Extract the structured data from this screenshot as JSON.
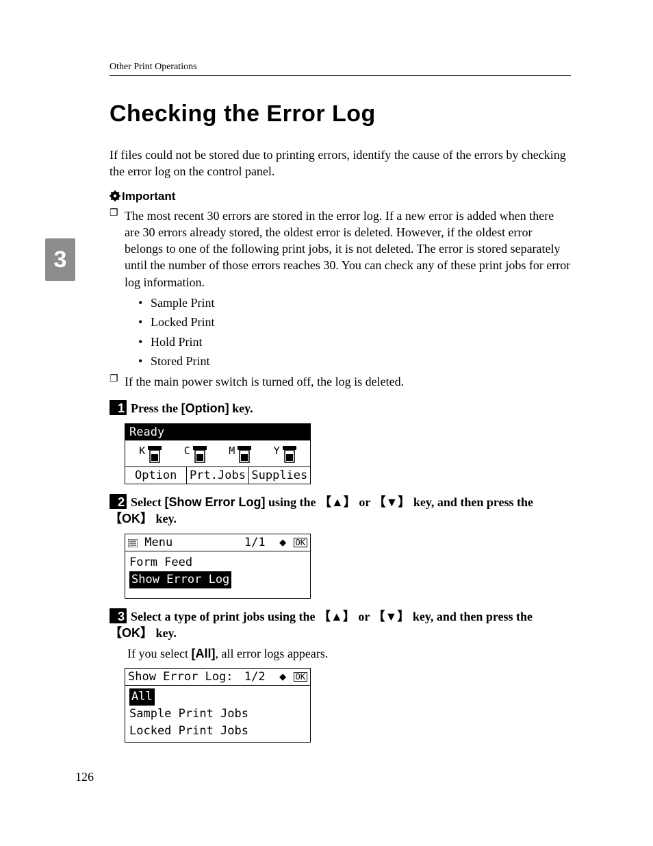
{
  "running_head": "Other Print Operations",
  "title": "Checking the Error Log",
  "chapter_tab": "3",
  "intro": "If files could not be stored due to printing errors, identify the cause of the errors by checking the error log on the control panel.",
  "important_label": "Important",
  "important_items": [
    "The most recent 30 errors are stored in the error log. If a new error is added when there are 30 errors already stored, the oldest error is deleted. However, if the oldest error belongs to one of the following print jobs, it is not deleted. The error is stored separately until the number of those errors reaches 30. You can check any of these print jobs for error log information.",
    "If the main power switch is turned off, the log is deleted."
  ],
  "print_job_types": [
    "Sample Print",
    "Locked Print",
    "Hold Print",
    "Stored Print"
  ],
  "steps": [
    {
      "num": "1",
      "text_prefix": "Press the ",
      "key": "[Option]",
      "text_suffix": " key."
    },
    {
      "num": "2",
      "text_prefix": "Select ",
      "key1": "[Show Error Log]",
      "mid": " using the ",
      "up": "▲",
      "or": " or ",
      "down": "▼",
      "mid2": " key, and then press the ",
      "ok": "OK",
      "suffix": " key."
    },
    {
      "num": "3",
      "text_prefix": "Select a type of print jobs using the ",
      "up": "▲",
      "or": " or ",
      "down": "▼",
      "mid2": " key, and then press the ",
      "ok": "OK",
      "suffix": " key.",
      "note_prefix": "If you select ",
      "note_key": "[All]",
      "note_suffix": ", all error logs appears."
    }
  ],
  "lcd_a": {
    "status": "Ready",
    "toners": [
      "K",
      "C",
      "M",
      "Y"
    ],
    "buttons": [
      "Option",
      "Prt.Jobs",
      "Supplies"
    ]
  },
  "lcd_b": {
    "title": "Menu",
    "page": "1/1",
    "ok": "OK",
    "item1": "Form Feed",
    "item2_selected": "Show Error Log"
  },
  "lcd_c": {
    "title": "Show Error Log:",
    "page": "1/2",
    "ok": "OK",
    "item1_selected": "All",
    "item2": "Sample Print Jobs",
    "item3": "Locked Print Jobs"
  },
  "page_number": "126"
}
